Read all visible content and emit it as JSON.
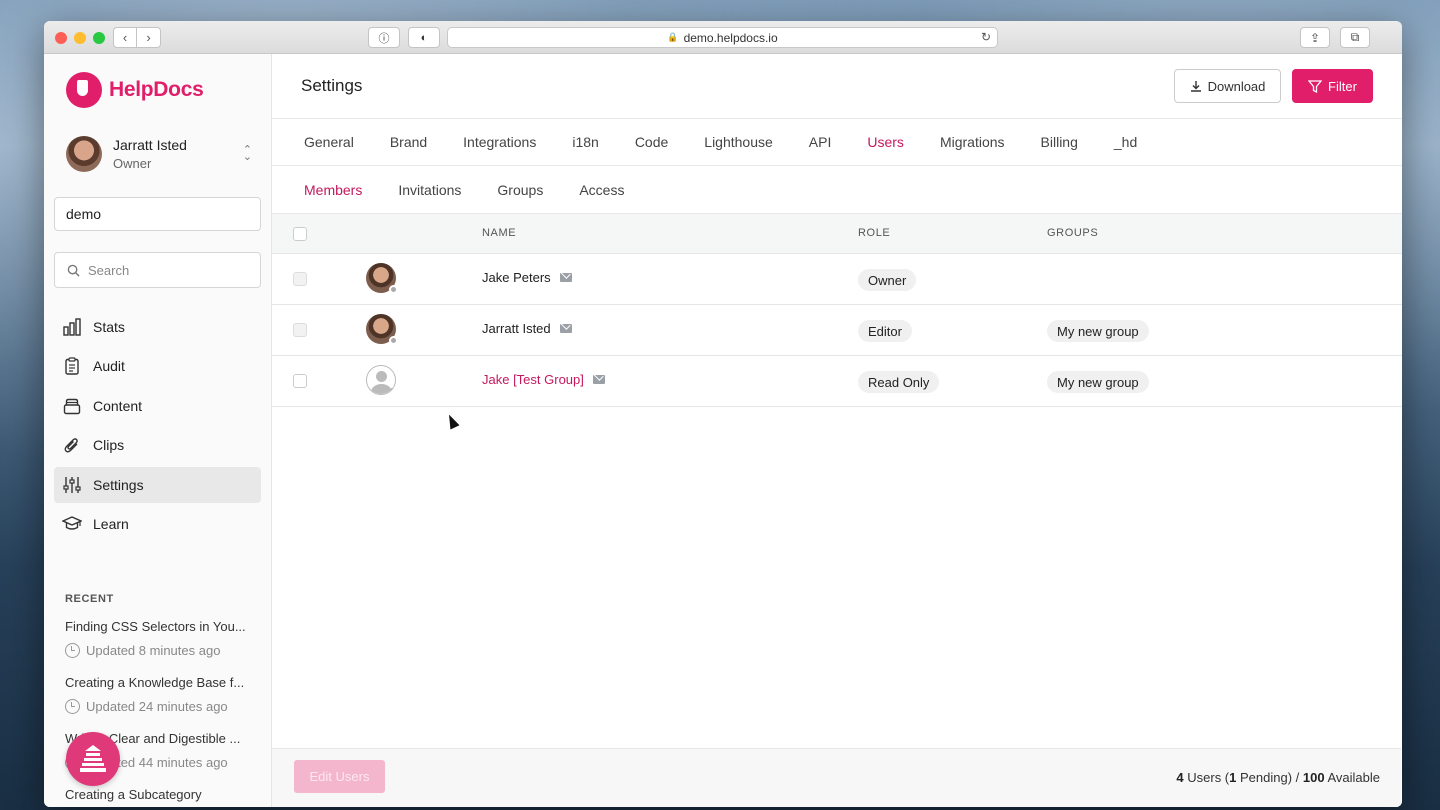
{
  "browser": {
    "url": "demo.helpdocs.io"
  },
  "app": {
    "brand": "HelpDocs",
    "colors": {
      "accent": "#e01e6a",
      "accent_text": "#c4185e"
    }
  },
  "sidebar": {
    "user": {
      "name": "Jarratt Isted",
      "role": "Owner"
    },
    "project": "demo",
    "search_placeholder": "Search",
    "nav": [
      {
        "label": "Stats",
        "icon": "bar-chart-icon"
      },
      {
        "label": "Audit",
        "icon": "clipboard-icon"
      },
      {
        "label": "Content",
        "icon": "archive-icon"
      },
      {
        "label": "Clips",
        "icon": "paperclip-icon"
      },
      {
        "label": "Settings",
        "icon": "sliders-icon",
        "active": true
      },
      {
        "label": "Learn",
        "icon": "graduation-cap-icon"
      }
    ],
    "recent_title": "RECENT",
    "recent": [
      {
        "name": "Finding CSS Selectors in You...",
        "time": "Updated 8 minutes ago"
      },
      {
        "name": "Creating a Knowledge Base f...",
        "time": "Updated 24 minutes ago"
      },
      {
        "name": "Writing Clear and Digestible ...",
        "time": "Updated 44 minutes ago"
      },
      {
        "name": "Creating a Subcategory",
        "time": ""
      }
    ]
  },
  "header": {
    "title": "Settings",
    "download_label": "Download",
    "filter_label": "Filter"
  },
  "tabs": [
    "General",
    "Brand",
    "Integrations",
    "i18n",
    "Code",
    "Lighthouse",
    "API",
    "Users",
    "Migrations",
    "Billing",
    "_hd"
  ],
  "active_tab": "Users",
  "subtabs": [
    "Members",
    "Invitations",
    "Groups",
    "Access"
  ],
  "active_subtab": "Members",
  "table": {
    "columns": {
      "name": "NAME",
      "role": "ROLE",
      "groups": "GROUPS"
    },
    "rows": [
      {
        "name": "Jake Peters",
        "role": "Owner",
        "group": "",
        "avatar": "photo",
        "link": false
      },
      {
        "name": "Jarratt Isted",
        "role": "Editor",
        "group": "My new group",
        "avatar": "photo",
        "link": false
      },
      {
        "name": "Jake [Test Group]",
        "role": "Read Only",
        "group": "My new group",
        "avatar": "blank",
        "link": true
      }
    ]
  },
  "footer": {
    "edit_label": "Edit Users",
    "users_count": "4",
    "users_text": " Users (",
    "pending_count": "1",
    "pending_text": " Pending) / ",
    "available_count": "100",
    "available_text": " Available"
  }
}
